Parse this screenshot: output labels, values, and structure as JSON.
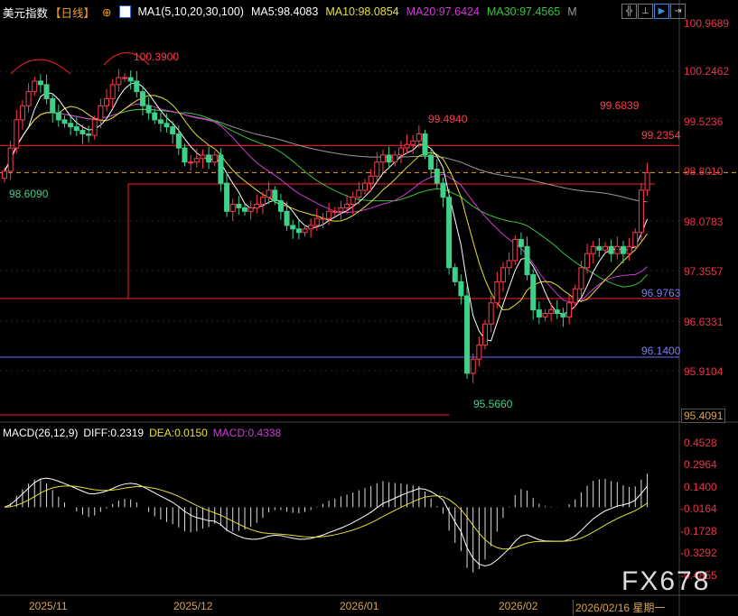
{
  "header": {
    "title": "美元指数",
    "period": "【日线】",
    "ma_label": "MA1(5,10,20,30,100)",
    "ma5": "MA5:98.4083",
    "ma10": "MA10:98.0854",
    "ma20": "MA20:97.6424",
    "ma30": "MA30:97.4565",
    "more": "M",
    "toolbar_icons": [
      "crosshair-icon",
      "range-icon",
      "play-icon",
      "step-icon"
    ]
  },
  "colors": {
    "up": "#ff3b4f",
    "down": "#3fd08a",
    "ma5": "#ffffff",
    "ma10": "#e6e030",
    "ma20": "#d03ad6",
    "ma30": "#37c43a",
    "ma100": "#9a9a9a",
    "axis": "#e8334a"
  },
  "annotations": {
    "high1": "100.3900",
    "high2": "99.4940",
    "high3": "99.6839",
    "line_red": "99.2354",
    "low1": "98.6090",
    "low2": "95.5660",
    "line_red2": "96.9763",
    "line_blue": "96.1400"
  },
  "macd_header": {
    "label": "MACD(26,12,9)",
    "diff": "DIFF:0.2319",
    "dea": "DEA:0.0150",
    "macd": "MACD:0.4338"
  },
  "dates": [
    "2025/11",
    "2025/12",
    "2026/01",
    "2026/02",
    "2026/02/16 星期一"
  ],
  "watermark": "FX678",
  "chart_data": [
    {
      "type": "candlestick",
      "title": "美元指数",
      "ylim": [
        95.4091,
        100.9689
      ],
      "y_ticks": [
        "100.9689",
        "100.2462",
        "99.5236",
        "98.8010",
        "98.0783",
        "97.3557",
        "96.6331",
        "95.9104",
        "95.4091"
      ],
      "x_ticks": [
        "2025/11",
        "2025/12",
        "2026/01",
        "2026/02"
      ],
      "closes": [
        98.87,
        99.2,
        99.6,
        99.8,
        100.0,
        100.15,
        100.1,
        99.9,
        99.7,
        99.6,
        99.55,
        99.5,
        99.45,
        99.4,
        99.38,
        99.6,
        99.8,
        99.9,
        100.1,
        100.2,
        100.2,
        100.15,
        100.0,
        99.8,
        99.7,
        99.6,
        99.55,
        99.5,
        99.4,
        99.2,
        99.0,
        99.0,
        99.05,
        99.1,
        99.0,
        99.1,
        98.7,
        98.3,
        98.4,
        98.35,
        98.3,
        98.35,
        98.4,
        98.5,
        98.6,
        98.45,
        98.3,
        98.1,
        98.05,
        98.0,
        98.05,
        98.1,
        98.2,
        98.2,
        98.3,
        98.3,
        98.35,
        98.4,
        98.5,
        98.6,
        98.7,
        98.8,
        99.0,
        99.1,
        99.0,
        99.1,
        99.2,
        99.25,
        99.3,
        99.4,
        99.1,
        98.9,
        98.7,
        98.5,
        97.5,
        97.3,
        97.1,
        96.0,
        96.2,
        96.4,
        96.7,
        97.0,
        97.3,
        97.5,
        97.6,
        97.9,
        97.8,
        97.4,
        96.9,
        96.8,
        96.85,
        96.9,
        96.85,
        96.8,
        97.0,
        97.2,
        97.5,
        97.7,
        97.8,
        97.75,
        97.8,
        97.7,
        97.8,
        97.7,
        97.8,
        98.0,
        98.6,
        98.85
      ],
      "hlines": [
        99.2354,
        98.85,
        96.9763,
        96.14
      ]
    },
    {
      "type": "macd",
      "y_ticks": [
        "0.4528",
        "0.2964",
        "0.1400",
        "-0.0164",
        "-0.1728",
        "-0.3292",
        "-0.4855"
      ],
      "ylim": [
        -0.4855,
        0.4528
      ]
    }
  ]
}
